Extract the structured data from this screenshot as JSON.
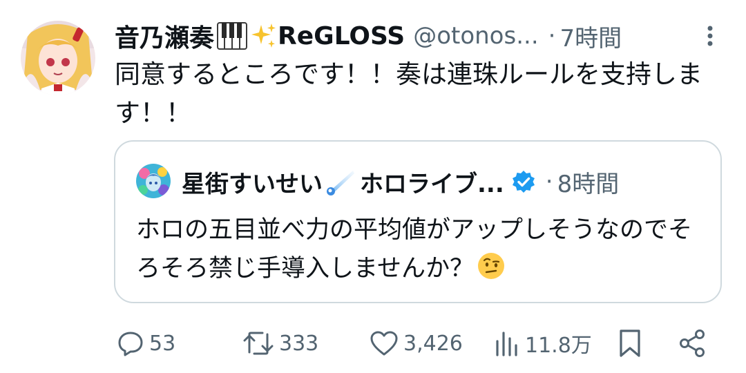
{
  "tweet": {
    "author_name": "音乃瀬奏",
    "author_name_suffix": "ReGLOSS",
    "handle": "@otonos...",
    "separator": "·",
    "time": "7時間",
    "text": "同意するところです！！奏は連珠ルールを支持します！！",
    "name_emoji_icons": [
      "piano-keys-icon",
      "sparkles-icon"
    ]
  },
  "quote": {
    "author_name": "星街すいせい",
    "author_name_suffix": "ホロライブ...",
    "separator": "·",
    "time": "8時間",
    "text": "ホロの五目並べ力の平均値がアップしそうなのでそろそろ禁じ手導入しませんか？",
    "verified_icon": "verified-badge-icon",
    "name_emoji_icon": "comet-icon",
    "trailing_emoji_icon": "face-with-raised-eyebrow-icon"
  },
  "actions": {
    "replies": "53",
    "retweets": "333",
    "likes": "3,426",
    "views": "11.8万"
  },
  "colors": {
    "text_primary": "#0f1419",
    "text_secondary": "#536471",
    "border": "#cfd9de",
    "verified_blue": "#1d9bf0"
  }
}
